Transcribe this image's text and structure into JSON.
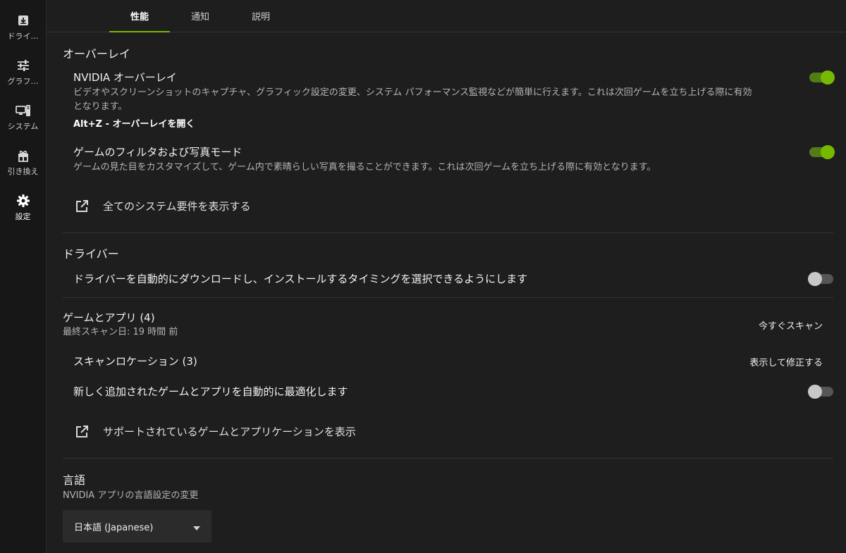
{
  "sidebar": {
    "items": [
      {
        "label": "ドライ…",
        "icon": "driver-download-icon"
      },
      {
        "label": "グラフ…",
        "icon": "sliders-icon"
      },
      {
        "label": "システム",
        "icon": "system-monitor-icon"
      },
      {
        "label": "引き換え",
        "icon": "gift-icon"
      },
      {
        "label": "設定",
        "icon": "gear-icon",
        "active": true
      }
    ]
  },
  "tabs": [
    {
      "label": "性能",
      "active": true
    },
    {
      "label": "通知"
    },
    {
      "label": "説明"
    }
  ],
  "overlay": {
    "section_title": "オーバーレイ",
    "nvidia_overlay": {
      "title": "NVIDIA オーバーレイ",
      "desc_line1": "ビデオやスクリーンショットのキャプチャ、グラフィック設定の変更、システム パフォーマンス監視などが簡単に行えます。これは次回ゲームを立ち上げる際に有効",
      "desc_line2": "となります。",
      "shortcut": "Alt+Z - オーバーレイを開く",
      "enabled": true
    },
    "game_filter": {
      "title": "ゲームのフィルタおよび写真モード",
      "desc": "ゲームの見た目をカスタマイズして、ゲーム内で素晴らしい写真を撮ることができます。これは次回ゲームを立ち上げる際に有効となります。",
      "enabled": true
    },
    "system_req_link": "全てのシステム要件を表示する"
  },
  "driver": {
    "section_title": "ドライバー",
    "auto_download": {
      "title": "ドライバーを自動的にダウンロードし、インストールするタイミングを選択できるようにします",
      "enabled": false
    }
  },
  "games": {
    "section_title": "ゲームとアプリ (4)",
    "last_scan": "最終スキャン日: 19 時間 前",
    "scan_now": "今すぐスキャン",
    "scan_locations": "スキャンロケーション (3)",
    "view_fix": "表示して修正する",
    "auto_optimize": {
      "title": "新しく追加されたゲームとアプリを自動的に最適化します",
      "enabled": false
    },
    "supported_link": "サポートされているゲームとアプリケーションを表示"
  },
  "language": {
    "section_title": "言語",
    "desc": "NVIDIA アプリの言語設定の変更",
    "selected": "日本語 (Japanese)"
  },
  "colors": {
    "accent": "#76b900",
    "background": "#1e1e1e",
    "sidebar": "#171717"
  }
}
